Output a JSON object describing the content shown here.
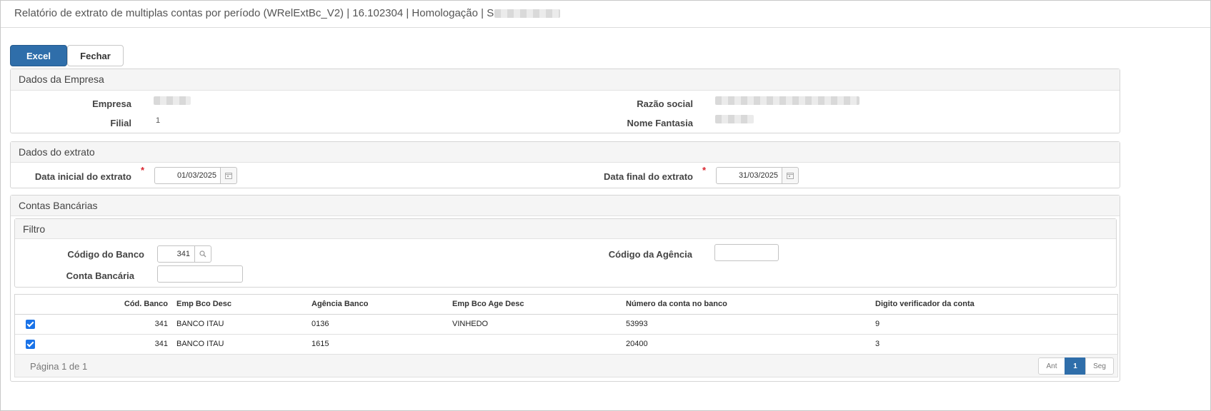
{
  "title": "Relatório de extrato de multiplas contas por período (WRelExtBc_V2) | 16.102304 | Homologação | S",
  "toolbar": {
    "excel_label": "Excel",
    "close_label": "Fechar"
  },
  "empresa_panel": {
    "heading": "Dados da Empresa",
    "empresa_label": "Empresa",
    "filial_label": "Filial",
    "filial_value": "1",
    "razao_label": "Razão social",
    "fantasia_label": "Nome Fantasia"
  },
  "extrato_panel": {
    "heading": "Dados do extrato",
    "data_inicial_label": "Data inicial do extrato",
    "data_inicial_value": "01/03/2025",
    "data_final_label": "Data final do extrato",
    "data_final_value": "31/03/2025",
    "required_mark": "*"
  },
  "contas_panel": {
    "heading": "Contas Bancárias",
    "filtro": {
      "heading": "Filtro",
      "codigo_banco_label": "Código do Banco",
      "codigo_banco_value": "341",
      "conta_label": "Conta Bancária",
      "agencia_label": "Código da Agência"
    },
    "table": {
      "headers": [
        "Cód. Banco",
        "Emp Bco Desc",
        "Agência Banco",
        "Emp Bco Age Desc",
        "Número da conta no banco",
        "Digito verificador da conta"
      ],
      "rows": [
        [
          "341",
          "BANCO ITAU",
          "0136",
          "VINHEDO",
          "53993",
          "9"
        ],
        [
          "341",
          "BANCO ITAU",
          "1615",
          "",
          "20400",
          "3"
        ]
      ]
    },
    "pagination": {
      "summary": "Página 1 de 1",
      "prev": "Ant",
      "current": "1",
      "next": "Seg"
    }
  },
  "colors": {
    "primary": "#2f6eaa",
    "required": "#d9232d",
    "checkbox": "#1a73e8"
  }
}
